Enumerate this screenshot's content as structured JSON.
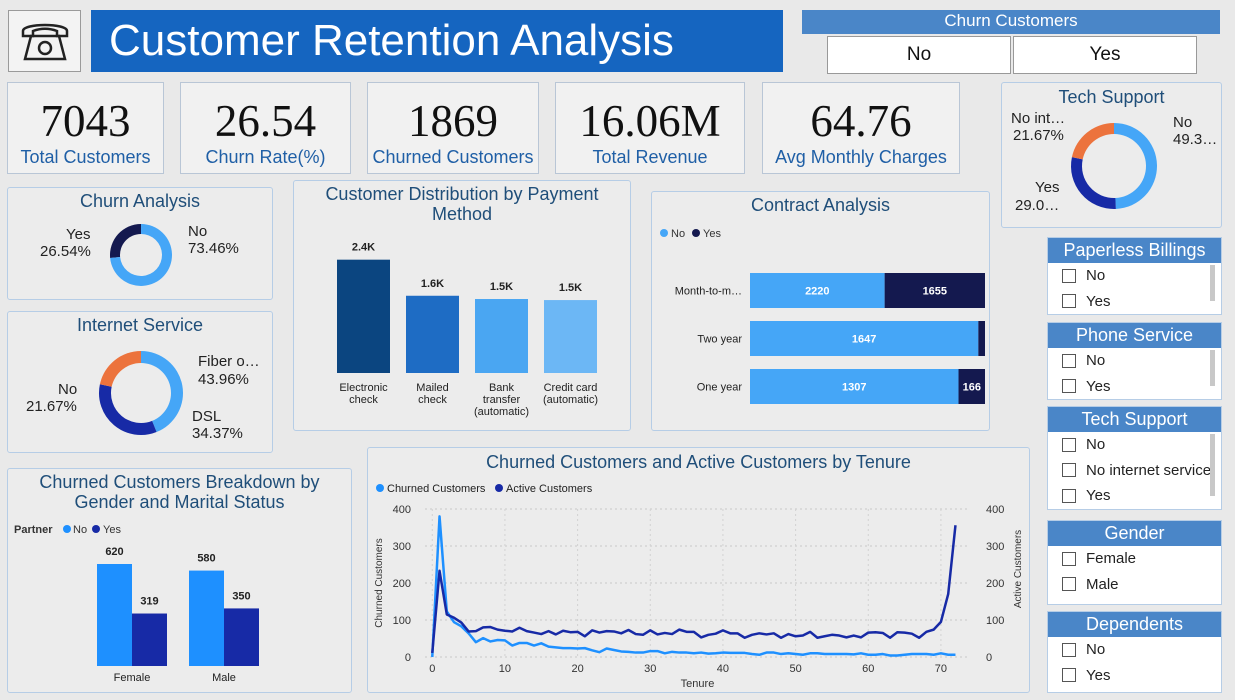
{
  "title": "Customer Retention Analysis",
  "logo_icon": "telephone-icon",
  "churn_slicer": {
    "title": "Churn Customers",
    "options": [
      "No",
      "Yes"
    ]
  },
  "kpis": [
    {
      "value": "7043",
      "label": "Total Customers"
    },
    {
      "value": "26.54",
      "label": "Churn Rate(%)"
    },
    {
      "value": "1869",
      "label": "Churned Customers"
    },
    {
      "value": "16.06M",
      "label": "Total Revenue"
    },
    {
      "value": "64.76",
      "label": "Avg Monthly Charges"
    }
  ],
  "colors": {
    "light_blue": "#45a6f7",
    "dark_navy": "#14194f",
    "orange": "#ec733d",
    "navy": "#172aa6",
    "title_blue": "#1565c0"
  },
  "churn_analysis": {
    "title": "Churn Analysis",
    "chart_data": {
      "type": "pie",
      "categories": [
        "Yes",
        "No"
      ],
      "values": [
        26.54,
        73.46
      ],
      "labels": [
        "26.54%",
        "73.46%"
      ]
    }
  },
  "internet_service": {
    "title": "Internet Service",
    "chart_data": {
      "type": "pie",
      "categories": [
        "Fiber o…",
        "DSL",
        "No"
      ],
      "values": [
        43.96,
        34.37,
        21.67
      ],
      "labels": [
        "43.96%",
        "34.37%",
        "21.67%"
      ]
    }
  },
  "tech_support_donut": {
    "title": "Tech Support",
    "chart_data": {
      "type": "pie",
      "categories": [
        "No",
        "Yes",
        "No int…"
      ],
      "values": [
        49.3,
        29.0,
        21.67
      ],
      "labels": [
        "49.3…",
        "29.0…",
        "21.67%"
      ]
    }
  },
  "payment": {
    "title": "Customer Distribution by Payment Method",
    "chart_data": {
      "type": "bar",
      "categories": [
        [
          "Electronic",
          "check"
        ],
        [
          "Mailed",
          "check"
        ],
        [
          "Bank",
          "transfer",
          "(automatic)"
        ],
        [
          "Credit card",
          "(automatic)"
        ]
      ],
      "values": [
        2365,
        1612,
        1544,
        1522
      ],
      "labels": [
        "2.4K",
        "1.6K",
        "1.5K",
        "1.5K"
      ],
      "colors": [
        "#0b4580",
        "#1e6cc4",
        "#4aa6f2",
        "#6cb7f5"
      ]
    }
  },
  "contract": {
    "title": "Contract Analysis",
    "chart_data": {
      "type": "bar",
      "legend": [
        "No",
        "Yes"
      ],
      "categories": [
        "Month-to-m…",
        "Two year",
        "One year"
      ],
      "series": [
        {
          "name": "No",
          "values": [
            2220,
            1647,
            1307
          ]
        },
        {
          "name": "Yes",
          "values": [
            1655,
            48,
            166
          ]
        }
      ],
      "labels_no": [
        "2220",
        "1647",
        "1307"
      ],
      "labels_yes": [
        "1655",
        "",
        "166"
      ]
    }
  },
  "gender": {
    "title": "Churned Customers Breakdown by Gender and Marital Status",
    "chart_data": {
      "type": "bar",
      "legend_title": "Partner",
      "legend": [
        "No",
        "Yes"
      ],
      "categories": [
        "Female",
        "Male"
      ],
      "series": [
        {
          "name": "No",
          "values": [
            620,
            580
          ]
        },
        {
          "name": "Yes",
          "values": [
            319,
            350
          ]
        }
      ]
    }
  },
  "tenure": {
    "title": "Churned Customers and Active Customers by Tenure",
    "chart_data": {
      "type": "line",
      "legend": [
        "Churned Customers",
        "Active Customers"
      ],
      "xlabel": "Tenure",
      "ylabel_left": "Churned Customers",
      "ylabel_right": "Active Customers",
      "xticks": [
        "0",
        "10",
        "20",
        "30",
        "40",
        "50",
        "60",
        "70"
      ],
      "yticks": [
        "0",
        "100",
        "200",
        "300",
        "400"
      ],
      "ylim": [
        0,
        400
      ],
      "xlim": [
        -1,
        74
      ],
      "x": [
        0,
        1,
        2,
        3,
        4,
        5,
        6,
        7,
        8,
        9,
        10,
        11,
        12,
        13,
        14,
        15,
        16,
        17,
        18,
        19,
        20,
        21,
        22,
        23,
        24,
        25,
        26,
        27,
        28,
        29,
        30,
        31,
        32,
        33,
        34,
        35,
        36,
        37,
        38,
        39,
        40,
        41,
        42,
        43,
        44,
        45,
        46,
        47,
        48,
        49,
        50,
        51,
        52,
        53,
        54,
        55,
        56,
        57,
        58,
        59,
        60,
        61,
        62,
        63,
        64,
        65,
        66,
        67,
        68,
        69,
        70,
        71,
        72
      ],
      "series": [
        {
          "name": "Churned Customers",
          "values": [
            0,
            380,
            123,
            94,
            83,
            64,
            40,
            51,
            42,
            46,
            45,
            31,
            38,
            38,
            31,
            37,
            28,
            26,
            24,
            24,
            23,
            24,
            18,
            13,
            23,
            19,
            15,
            14,
            12,
            12,
            16,
            16,
            10,
            14,
            12,
            12,
            10,
            12,
            9,
            10,
            12,
            11,
            11,
            11,
            8,
            6,
            12,
            12,
            8,
            10,
            8,
            6,
            10,
            10,
            8,
            8,
            8,
            8,
            7,
            10,
            6,
            6,
            8,
            4,
            4,
            6,
            8,
            8,
            8,
            6,
            10,
            6,
            6
          ]
        },
        {
          "name": "Active Customers",
          "values": [
            11,
            233,
            115,
            106,
            93,
            69,
            70,
            80,
            81,
            74,
            71,
            69,
            79,
            70,
            66,
            62,
            70,
            61,
            71,
            67,
            68,
            56,
            72,
            66,
            70,
            69,
            64,
            73,
            62,
            60,
            72,
            61,
            65,
            62,
            74,
            68,
            68,
            53,
            60,
            63,
            72,
            64,
            64,
            52,
            60,
            64,
            61,
            64,
            52,
            62,
            56,
            58,
            68,
            52,
            56,
            60,
            58,
            53,
            58,
            53,
            66,
            67,
            65,
            52,
            67,
            66,
            63,
            52,
            68,
            74,
            95,
            170,
            356
          ]
        }
      ]
    }
  },
  "slicers": [
    {
      "title": "Paperless Billings",
      "items": [
        "No",
        "Yes"
      ]
    },
    {
      "title": "Phone Service",
      "items": [
        "No",
        "Yes"
      ]
    },
    {
      "title": "Tech Support",
      "items": [
        "No",
        "No internet service",
        "Yes"
      ]
    },
    {
      "title": "Gender",
      "items": [
        "Female",
        "Male"
      ]
    },
    {
      "title": "Dependents",
      "items": [
        "No",
        "Yes"
      ]
    }
  ]
}
